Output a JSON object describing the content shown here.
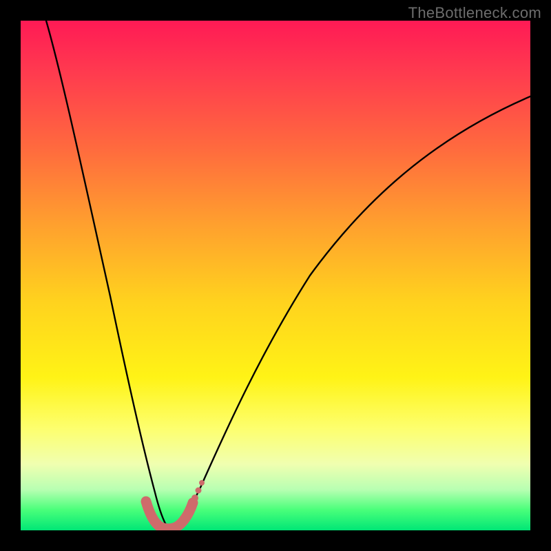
{
  "watermark": "TheBottleneck.com",
  "chart_data": {
    "type": "line",
    "title": "",
    "xlabel": "",
    "ylabel": "",
    "xlim": [
      0,
      100
    ],
    "ylim": [
      0,
      100
    ],
    "annotations": [],
    "series": [
      {
        "name": "bottleneck-curve",
        "x": [
          5,
          8,
          11,
          14,
          17,
          20,
          23,
          25,
          27,
          29,
          31,
          34,
          38,
          43,
          50,
          60,
          72,
          85,
          100
        ],
        "y": [
          100,
          86,
          73,
          60,
          48,
          36,
          24,
          15,
          7,
          2,
          5,
          14,
          26,
          39,
          52,
          63,
          73,
          80,
          85
        ]
      }
    ],
    "highlight": {
      "name": "optimal-range",
      "x_range": [
        24,
        31
      ],
      "y_range": [
        0,
        6
      ]
    },
    "colors": {
      "curve": "#000000",
      "highlight": "#ce6b6b",
      "gradient_top": "#ff1a55",
      "gradient_bottom": "#00e676"
    }
  }
}
